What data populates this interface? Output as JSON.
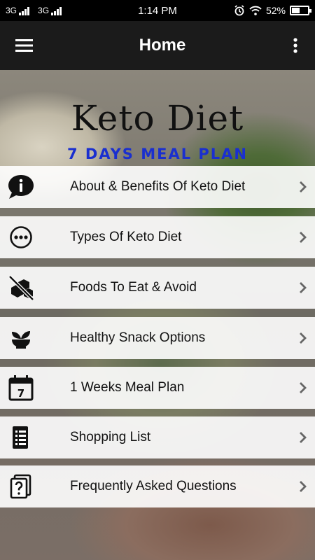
{
  "status_bar": {
    "network1": "3G",
    "network2": "3G",
    "time": "1:14 PM",
    "battery": "52%",
    "battery_level": 0.52
  },
  "app_bar": {
    "title": "Home",
    "menu_icon": "hamburger-menu-icon",
    "more_icon": "more-vert-icon"
  },
  "hero": {
    "title": "Keto Diet",
    "subtitle": "7 DAYS MEAL PLAN"
  },
  "menu": {
    "items": [
      {
        "label": "About & Benefits Of Keto Diet",
        "icon": "info-chat-icon"
      },
      {
        "label": "Types Of Keto Diet",
        "icon": "more-horizontal-circle-icon"
      },
      {
        "label": "Foods To Eat & Avoid",
        "icon": "no-sugar-icon"
      },
      {
        "label": "Healthy Snack Options",
        "icon": "plant-bowl-icon"
      },
      {
        "label": "1 Weeks Meal Plan",
        "icon": "calendar-7-icon"
      },
      {
        "label": "Shopping List",
        "icon": "list-document-icon"
      },
      {
        "label": "Frequently Asked Questions",
        "icon": "question-document-icon"
      }
    ]
  },
  "colors": {
    "app_bar": "#1b1b1b",
    "subtitle": "#1a2fcf",
    "item_bg": "#ffffff"
  }
}
